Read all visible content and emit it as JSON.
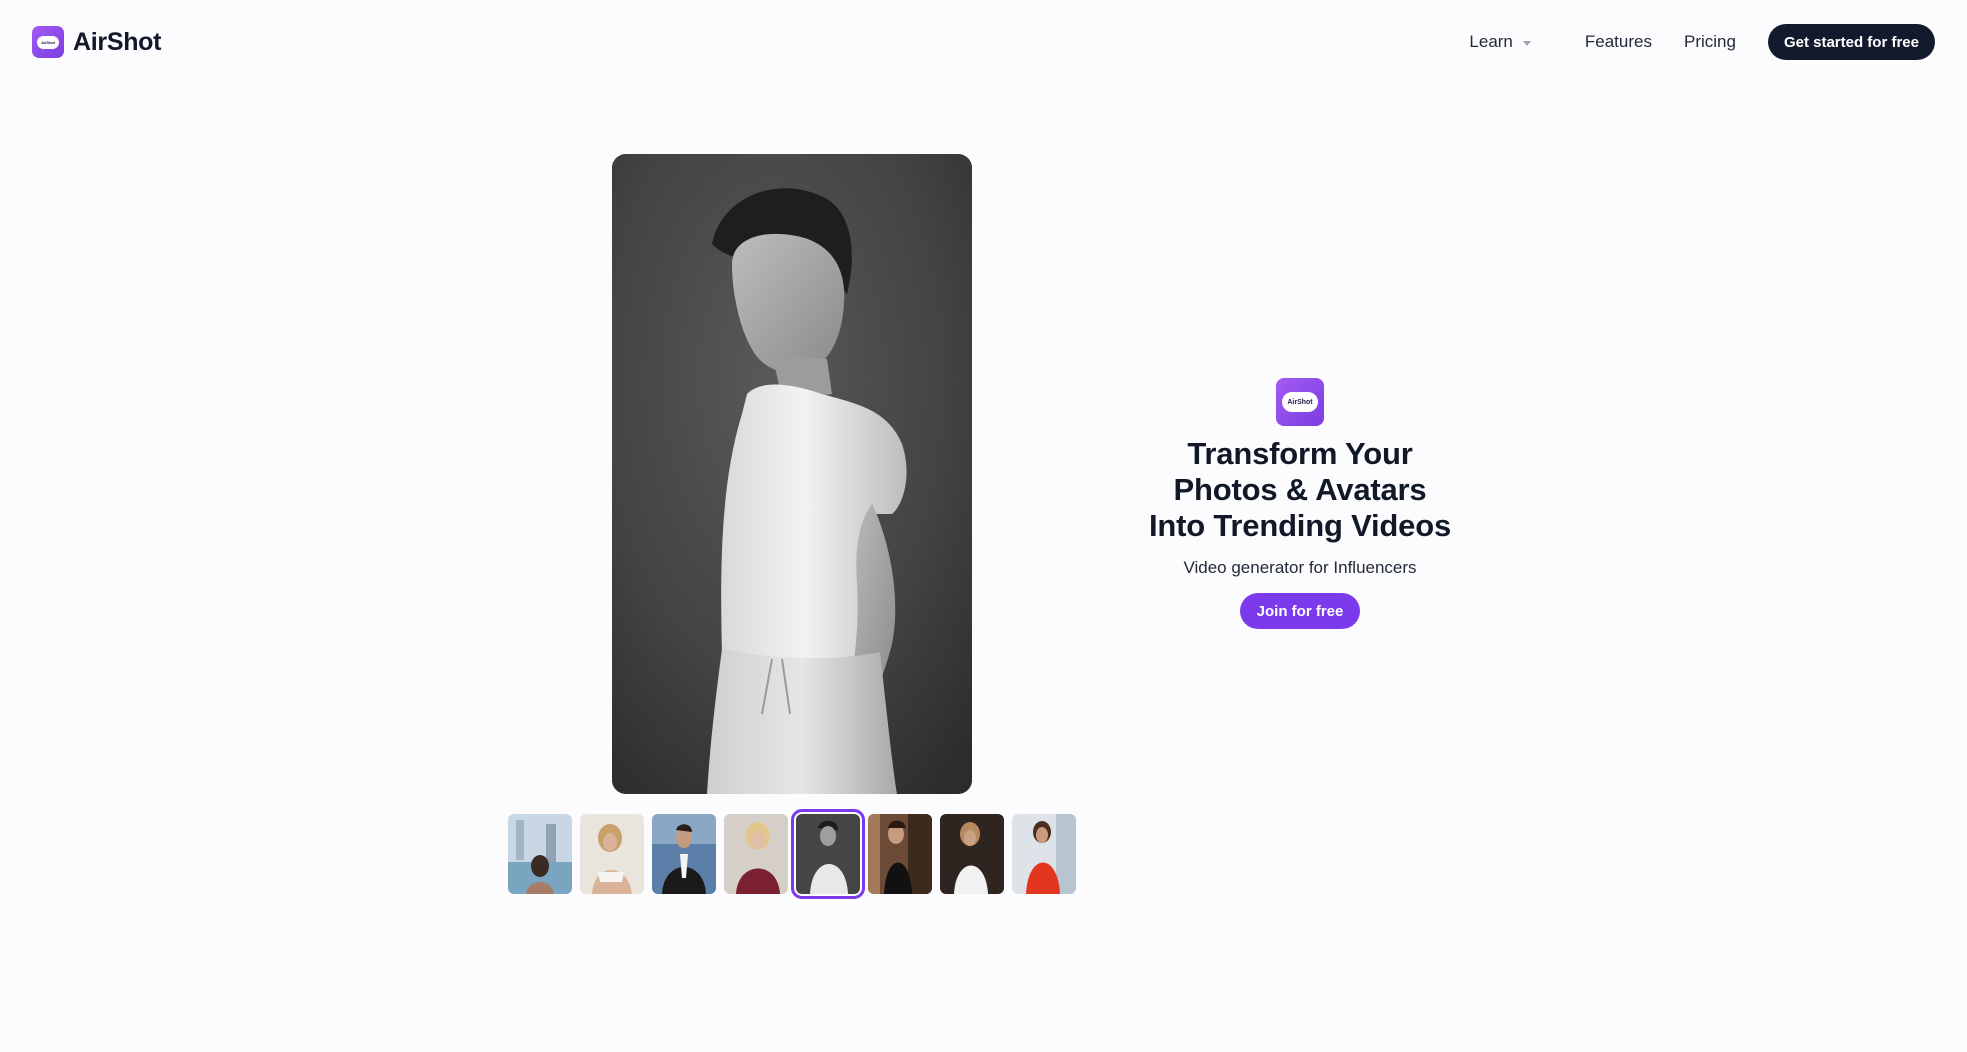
{
  "header": {
    "brand_name": "AirShot",
    "logo_text": "AirShot",
    "nav": {
      "learn_label": "Learn",
      "features_label": "Features",
      "pricing_label": "Pricing"
    },
    "cta_label": "Get started for free"
  },
  "hero": {
    "logo_text": "AirShot",
    "title_lines": [
      "Transform Your",
      "Photos & Avatars",
      "Into Trending Videos"
    ],
    "subtitle": "Video generator for Influencers",
    "cta_label": "Join for free"
  },
  "gallery": {
    "selected_index": 4,
    "thumbnails": [
      {
        "name": "thumbnail-1"
      },
      {
        "name": "thumbnail-2"
      },
      {
        "name": "thumbnail-3"
      },
      {
        "name": "thumbnail-4"
      },
      {
        "name": "thumbnail-5"
      },
      {
        "name": "thumbnail-6"
      },
      {
        "name": "thumbnail-7"
      },
      {
        "name": "thumbnail-8"
      }
    ]
  },
  "colors": {
    "accent": "#7c3aed",
    "dark_button": "#141a2e",
    "background": "#fcfcfe"
  }
}
